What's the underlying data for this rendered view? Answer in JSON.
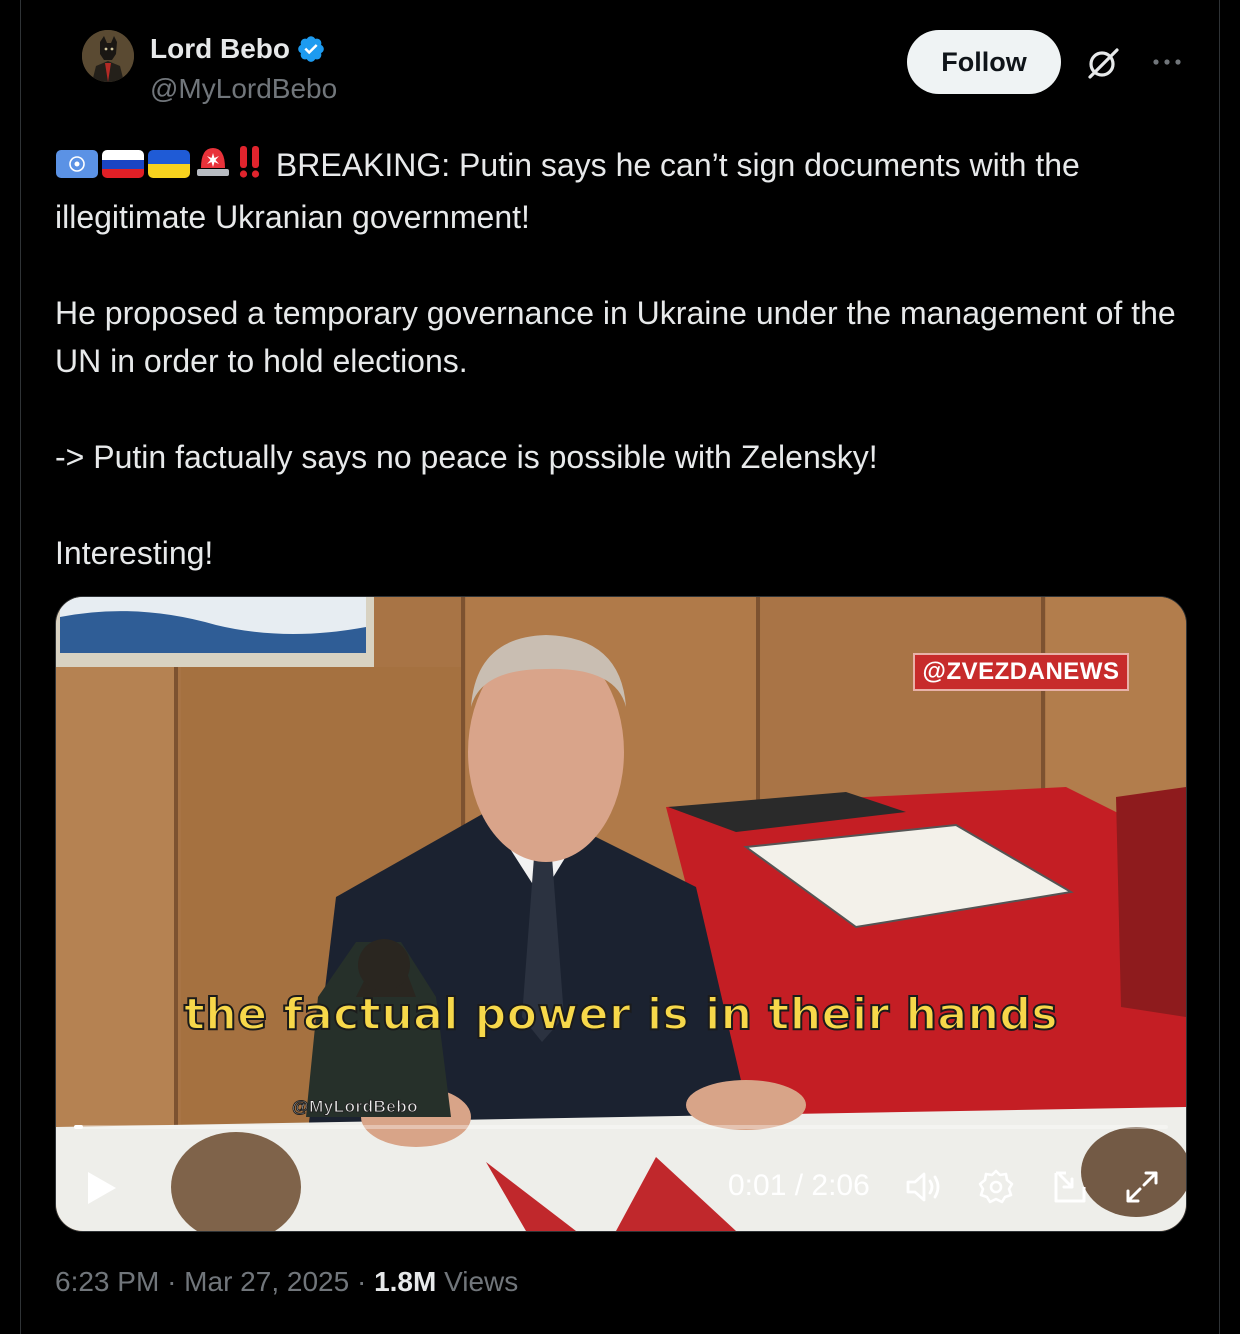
{
  "author": {
    "name": "Lord Bebo",
    "handle": "@MyLordBebo",
    "verified": true
  },
  "actions": {
    "follow_label": "Follow"
  },
  "icons": {
    "verified": "verified-badge-icon",
    "grok": "grok-icon",
    "more": "more-icon"
  },
  "tweet": {
    "line1": "BREAKING: Putin says he can’t sign documents with the illegitimate Ukranian government!",
    "line2": "He proposed a temporary governance in Ukraine under the management of the UN in order to hold elections.",
    "line3": "-> Putin factually says no peace is possible with Zelensky!",
    "line4": "Interesting!",
    "emojis": [
      "un-flag-icon",
      "russia-flag-icon",
      "ukraine-flag-icon",
      "siren-icon",
      "double-exclamation-icon"
    ]
  },
  "video": {
    "source_tag": "@ZVEZDANEWS",
    "subtitle": "the factual power is in their hands",
    "overlay_handle": "@MyLordBebo",
    "current_time": "0:01",
    "duration": "2:06",
    "time_display": "0:01 / 2:06",
    "progress_fraction": 0.008
  },
  "meta": {
    "time": "6:23 PM",
    "date": "Mar 27, 2025",
    "views_count": "1.8M",
    "views_label": "Views"
  },
  "colors": {
    "background": "#000000",
    "text": "#e7e9ea",
    "muted": "#71767b",
    "verified": "#1d9bf0",
    "subtitle": "#f7d84a",
    "news_tag": "#c72b2b"
  }
}
